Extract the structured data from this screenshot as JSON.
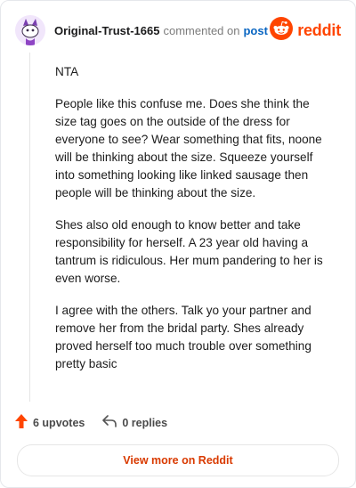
{
  "header": {
    "username": "Original-Trust-1665",
    "action_text": "commented on",
    "post_link": "post",
    "brand": "reddit"
  },
  "comment": {
    "paragraphs": [
      "NTA",
      "People like this confuse me. Does she think the size tag goes on the outside of the dress for everyone to see? Wear something that fits, noone will be thinking about the size. Squeeze yourself into something looking like linked sausage then people will be thinking about the size.",
      "Shes also old enough to know better and take responsibility for herself. A 23 year old having a tantrum is ridiculous. Her mum pandering to her is even worse.",
      "I agree with the others. Talk yo your partner and remove her from the bridal party. Shes already proved herself too much trouble over something pretty basic"
    ]
  },
  "footer": {
    "upvotes_label": "6 upvotes",
    "replies_label": "0 replies",
    "view_more_label": "View more on Reddit"
  },
  "icons": {
    "avatar": "snoo-avatar-icon",
    "brand": "reddit-logo-icon",
    "upvote": "upvote-arrow-icon",
    "reply": "reply-arrow-icon"
  },
  "colors": {
    "brand": "#ff4500",
    "upvote": "#ff4500",
    "link": "#0a66c2",
    "view_more": "#d93a00"
  }
}
